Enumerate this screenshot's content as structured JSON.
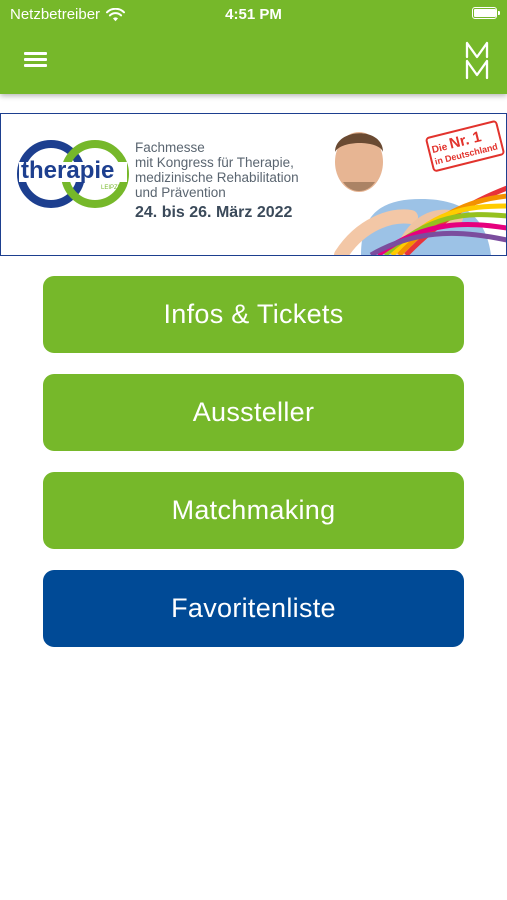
{
  "status_bar": {
    "carrier": "Netzbetreiber",
    "time": "4:51 PM",
    "battery_level": 0.95
  },
  "header": {
    "menu_icon": "hamburger-menu-icon",
    "logo_icon": "leipziger-messe-logo-icon",
    "background_color": "#76b82a"
  },
  "banner": {
    "logo_word": "therapie",
    "logo_sub": "LEIPZIG",
    "text_lines": [
      "Fachmesse",
      "mit Kongress für Therapie,",
      "medizinische Rehabilitation",
      "und Prävention"
    ],
    "date": "24. bis 26. März 2022",
    "badge": {
      "prefix": "Die",
      "big": "Nr. 1",
      "line2": "in Deutschland"
    }
  },
  "menu_buttons": [
    {
      "label": "Infos & Tickets",
      "color": "#76b82a"
    },
    {
      "label": "Aussteller",
      "color": "#76b82a"
    },
    {
      "label": "Matchmaking",
      "color": "#76b82a"
    },
    {
      "label": "Favoritenliste",
      "color": "#004a96"
    }
  ]
}
